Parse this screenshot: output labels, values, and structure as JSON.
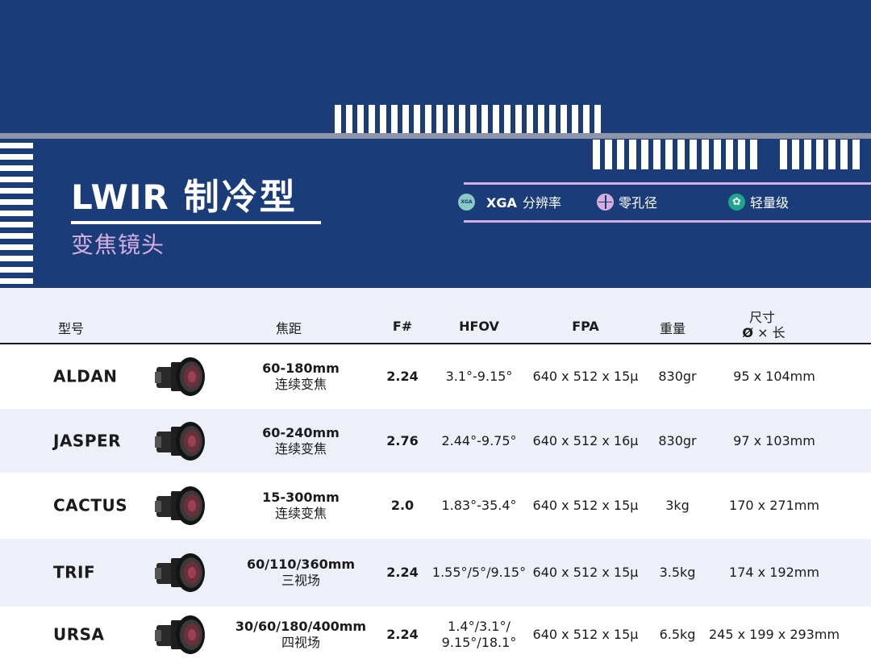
{
  "header": {
    "title_en": "LWIR",
    "title_cn": "制冷型",
    "subtitle": "变焦镜头",
    "features": [
      {
        "icon": "xga-icon",
        "icon_text": "XGA",
        "bold": "XGA",
        "label": "分辨率"
      },
      {
        "icon": "crosshair-icon",
        "label": "零孔径"
      },
      {
        "icon": "leaf-icon",
        "label": "轻量级"
      }
    ],
    "colors": {
      "banner": "#1a3d79",
      "accent": "#d6aedf",
      "row_shade": "#eef0f9"
    }
  },
  "table": {
    "columns": {
      "model": "型号",
      "focal": "焦距",
      "fnum": "F#",
      "hfov": "HFOV",
      "fpa": "FPA",
      "weight": "重量",
      "size_line1": "尺寸",
      "size_line2_sym": "Ø",
      "size_line2_rest": "× 长"
    },
    "rows": [
      {
        "model": "ALDAN",
        "focal": "60-180mm",
        "zoom_type": "连续变焦",
        "fnum": "2.24",
        "hfov": "3.1°-9.15°",
        "hfov2": "",
        "fpa": "640 x 512 x 15μ",
        "weight": "830gr",
        "size": "95 x 104mm"
      },
      {
        "model": "JASPER",
        "focal": "60-240mm",
        "zoom_type": "连续变焦",
        "fnum": "2.76",
        "hfov": "2.44°-9.75°",
        "hfov2": "",
        "fpa": "640 x 512 x 16μ",
        "weight": "830gr",
        "size": "97 x 103mm"
      },
      {
        "model": "CACTUS",
        "focal": "15-300mm",
        "zoom_type": "连续变焦",
        "fnum": "2.0",
        "hfov": "1.83°-35.4°",
        "hfov2": "",
        "fpa": "640 x 512 x 15μ",
        "weight": "3kg",
        "size": "170 x 271mm"
      },
      {
        "model": "TRIF",
        "focal": "60/110/360mm",
        "zoom_type": "三视场",
        "fnum": "2.24",
        "hfov": "1.55°/5°/9.15°",
        "hfov2": "",
        "fpa": "640 x 512 x 15μ",
        "weight": "3.5kg",
        "size": "174 x 192mm"
      },
      {
        "model": "URSA",
        "focal": "30/60/180/400mm",
        "zoom_type": "四视场",
        "fnum": "2.24",
        "hfov": "1.4°/3.1°/",
        "hfov2": "9.15°/18.1°",
        "fpa": "640 x 512 x 15μ",
        "weight": "6.5kg",
        "size": "245 x 199 x 293mm"
      }
    ]
  }
}
